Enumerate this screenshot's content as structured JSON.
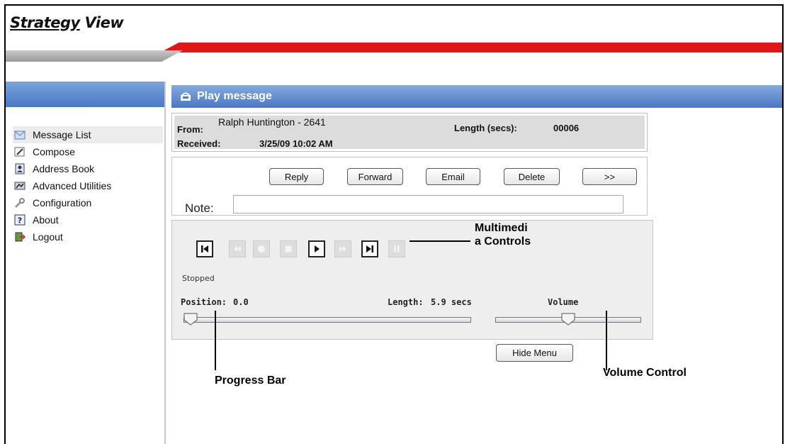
{
  "app": {
    "logo_part1": "Strategy",
    "logo_part2": " View"
  },
  "sidebar": {
    "items": [
      {
        "label": "Message List",
        "icon": "message-list-icon"
      },
      {
        "label": "Compose",
        "icon": "compose-icon"
      },
      {
        "label": "Address Book",
        "icon": "address-book-icon"
      },
      {
        "label": "Advanced Utilities",
        "icon": "advanced-utilities-icon"
      },
      {
        "label": "Configuration",
        "icon": "wrench-icon"
      },
      {
        "label": "About",
        "icon": "question-icon"
      },
      {
        "label": "Logout",
        "icon": "logout-icon"
      }
    ]
  },
  "header": {
    "title": "Play message"
  },
  "message": {
    "from_label": "From:",
    "from_value": "Ralph Huntington - 2641",
    "received_label": "Received:",
    "received_value": "3/25/09 10:02 AM",
    "length_label": "Length (secs):",
    "length_value": "00006"
  },
  "actions": {
    "reply": "Reply",
    "forward": "Forward",
    "email": "Email",
    "delete": "Delete",
    "more": ">>",
    "note_label": "Note:",
    "note_value": ""
  },
  "player": {
    "status": "Stopped",
    "position_label": "Position:",
    "position_value": "0.0",
    "length_label": "Length:",
    "length_value": "5.9 secs",
    "volume_label": "Volume",
    "position_fraction": 0.0,
    "volume_fraction": 0.5,
    "hide_menu": "Hide Menu"
  },
  "callouts": {
    "multimedia_line1": "Multimedi",
    "multimedia_line2": "a Controls",
    "progress_bar": "Progress Bar",
    "volume_control": "Volume Control"
  },
  "colors": {
    "accent_blue": "#4b77c2",
    "brand_red": "#e3151b"
  }
}
